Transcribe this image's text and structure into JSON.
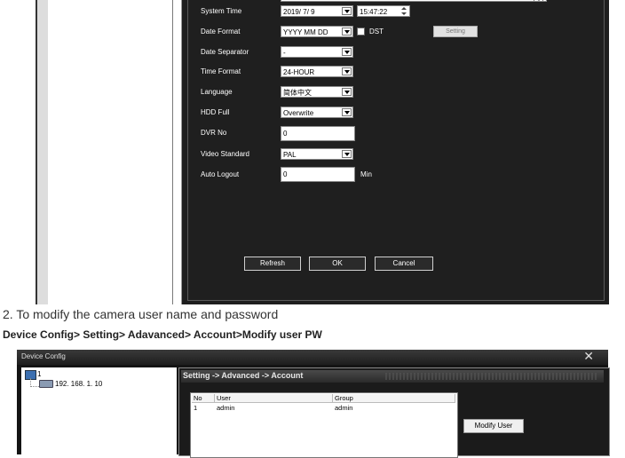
{
  "top_screenshot": {
    "rows": {
      "system_time": {
        "label": "System Time",
        "date": "2019/ 7/ 9",
        "time": "15:47:22"
      },
      "date_format": {
        "label": "Date Format",
        "value": "YYYY MM DD",
        "dst_label": "DST",
        "setting_label": "Setting"
      },
      "date_separator": {
        "label": "Date Separator",
        "value": "-"
      },
      "time_format": {
        "label": "Time Format",
        "value": "24-HOUR"
      },
      "language": {
        "label": "Language",
        "value": "简体中文"
      },
      "hdd_full": {
        "label": "HDD Full",
        "value": "Overwrite"
      },
      "dvr_no": {
        "label": "DVR No",
        "value": "0"
      },
      "video_standard": {
        "label": "Video Standard",
        "value": "PAL"
      },
      "auto_logout": {
        "label": "Auto Logout",
        "value": "0",
        "unit": "Min"
      }
    },
    "buttons": {
      "refresh": "Refresh",
      "ok": "OK",
      "cancel": "Cancel"
    }
  },
  "caption": {
    "step": "2. To modify the camera user name and password",
    "path": "Device Config> Setting> Adavanced> Account>Modify user PW"
  },
  "bottom_screenshot": {
    "window_title": "Device Config",
    "close_glyph": "✕",
    "tree": {
      "root_label": "1",
      "device_label": "192. 168. 1. 10"
    },
    "breadcrumb": "Setting -> Advanced -> Account",
    "table": {
      "columns": [
        "No",
        "User",
        "Group"
      ],
      "rows": [
        {
          "no": "1",
          "user": "admin",
          "group": "admin"
        }
      ]
    },
    "modify_user_label": "Modify User"
  }
}
